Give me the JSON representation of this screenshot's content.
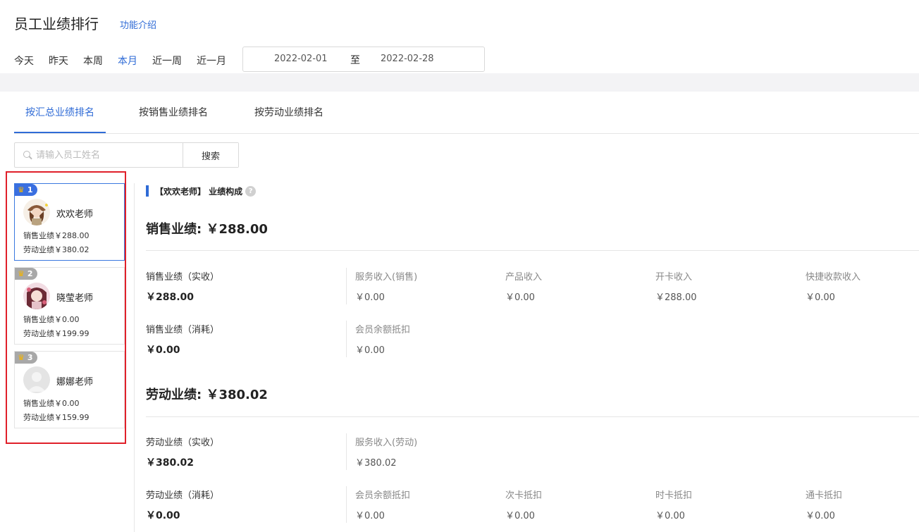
{
  "header": {
    "title": "员工业绩排行",
    "feature_link": "功能介绍"
  },
  "period_tabs": [
    {
      "label": "今天",
      "active": false
    },
    {
      "label": "昨天",
      "active": false
    },
    {
      "label": "本周",
      "active": false
    },
    {
      "label": "本月",
      "active": true
    },
    {
      "label": "近一周",
      "active": false
    },
    {
      "label": "近一月",
      "active": false
    }
  ],
  "date_range": {
    "start": "2022-02-01",
    "separator": "至",
    "end": "2022-02-28"
  },
  "rank_tabs": [
    {
      "label": "按汇总业绩排名",
      "active": true
    },
    {
      "label": "按销售业绩排名",
      "active": false
    },
    {
      "label": "按劳动业绩排名",
      "active": false
    }
  ],
  "search": {
    "placeholder": "请输入员工姓名",
    "button": "搜索"
  },
  "staff": [
    {
      "rank": "1",
      "name": "欢欢老师",
      "sales": "销售业绩￥288.00",
      "labor": "劳动业绩￥380.02"
    },
    {
      "rank": "2",
      "name": "晓莹老师",
      "sales": "销售业绩￥0.00",
      "labor": "劳动业绩￥199.99"
    },
    {
      "rank": "3",
      "name": "娜娜老师",
      "sales": "销售业绩￥0.00",
      "labor": "劳动业绩￥159.99"
    }
  ],
  "detail": {
    "title": "【欢欢老师】 业绩构成",
    "sales_title": "销售业绩: ￥288.00",
    "sales_actual": {
      "label": "销售业绩（实收）",
      "value": "￥288.00"
    },
    "sales_actual_items": [
      {
        "label": "服务收入(销售)",
        "value": "￥0.00"
      },
      {
        "label": "产品收入",
        "value": "￥0.00"
      },
      {
        "label": "开卡收入",
        "value": "￥288.00"
      },
      {
        "label": "快捷收款收入",
        "value": "￥0.00"
      }
    ],
    "sales_consume": {
      "label": "销售业绩（消耗）",
      "value": "￥0.00"
    },
    "sales_consume_items": [
      {
        "label": "会员余额抵扣",
        "value": "￥0.00"
      }
    ],
    "labor_title": "劳动业绩: ￥380.02",
    "labor_actual": {
      "label": "劳动业绩（实收）",
      "value": "￥380.02"
    },
    "labor_actual_items": [
      {
        "label": "服务收入(劳动)",
        "value": "￥380.02"
      }
    ],
    "labor_consume": {
      "label": "劳动业绩（消耗）",
      "value": "￥0.00"
    },
    "labor_consume_items": [
      {
        "label": "会员余额抵扣",
        "value": "￥0.00"
      },
      {
        "label": "次卡抵扣",
        "value": "￥0.00"
      },
      {
        "label": "时卡抵扣",
        "value": "￥0.00"
      },
      {
        "label": "通卡抵扣",
        "value": "￥0.00"
      }
    ]
  },
  "icons": {
    "search": "search-icon",
    "crown": "crown-icon",
    "help": "help-icon"
  },
  "colors": {
    "accent": "#2f6bd6",
    "highlight": "#e0202a"
  }
}
